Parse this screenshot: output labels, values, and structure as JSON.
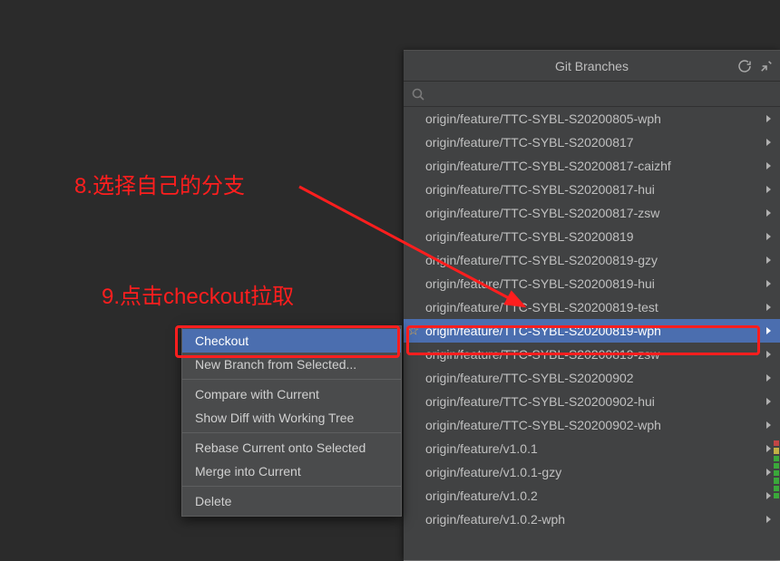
{
  "annotations": {
    "step8": "8.选择自己的分支",
    "step9": "9.点击checkout拉取"
  },
  "branches_popup": {
    "title": "Git Branches",
    "search_placeholder": "",
    "items": [
      {
        "label": "origin/feature/TTC-SYBL-S20200805-wph",
        "selected": false,
        "starred": false
      },
      {
        "label": "origin/feature/TTC-SYBL-S20200817",
        "selected": false,
        "starred": false
      },
      {
        "label": "origin/feature/TTC-SYBL-S20200817-caizhf",
        "selected": false,
        "starred": false
      },
      {
        "label": "origin/feature/TTC-SYBL-S20200817-hui",
        "selected": false,
        "starred": false
      },
      {
        "label": "origin/feature/TTC-SYBL-S20200817-zsw",
        "selected": false,
        "starred": false
      },
      {
        "label": "origin/feature/TTC-SYBL-S20200819",
        "selected": false,
        "starred": false
      },
      {
        "label": "origin/feature/TTC-SYBL-S20200819-gzy",
        "selected": false,
        "starred": false
      },
      {
        "label": "origin/feature/TTC-SYBL-S20200819-hui",
        "selected": false,
        "starred": false
      },
      {
        "label": "origin/feature/TTC-SYBL-S20200819-test",
        "selected": false,
        "starred": false
      },
      {
        "label": "origin/feature/TTC-SYBL-S20200819-wph",
        "selected": true,
        "starred": true
      },
      {
        "label": "origin/feature/TTC-SYBL-S20200819-zsw",
        "selected": false,
        "starred": false
      },
      {
        "label": "origin/feature/TTC-SYBL-S20200902",
        "selected": false,
        "starred": false
      },
      {
        "label": "origin/feature/TTC-SYBL-S20200902-hui",
        "selected": false,
        "starred": false
      },
      {
        "label": "origin/feature/TTC-SYBL-S20200902-wph",
        "selected": false,
        "starred": false
      },
      {
        "label": "origin/feature/v1.0.1",
        "selected": false,
        "starred": false
      },
      {
        "label": "origin/feature/v1.0.1-gzy",
        "selected": false,
        "starred": false
      },
      {
        "label": "origin/feature/v1.0.2",
        "selected": false,
        "starred": false
      },
      {
        "label": "origin/feature/v1.0.2-wph",
        "selected": false,
        "starred": false
      }
    ]
  },
  "context_menu": {
    "items": [
      {
        "label": "Checkout",
        "selected": true
      },
      {
        "label": "New Branch from Selected...",
        "selected": false
      },
      {
        "sep": true
      },
      {
        "label": "Compare with Current",
        "selected": false
      },
      {
        "label": "Show Diff with Working Tree",
        "selected": false
      },
      {
        "sep": true
      },
      {
        "label": "Rebase Current onto Selected",
        "selected": false
      },
      {
        "label": "Merge into Current",
        "selected": false
      },
      {
        "sep": true
      },
      {
        "label": "Delete",
        "selected": false
      }
    ]
  },
  "colors": {
    "annotation": "#ff1e1e",
    "selection": "#4b6eaf",
    "popup_bg": "#414243",
    "editor_bg": "#2b2b2b"
  }
}
